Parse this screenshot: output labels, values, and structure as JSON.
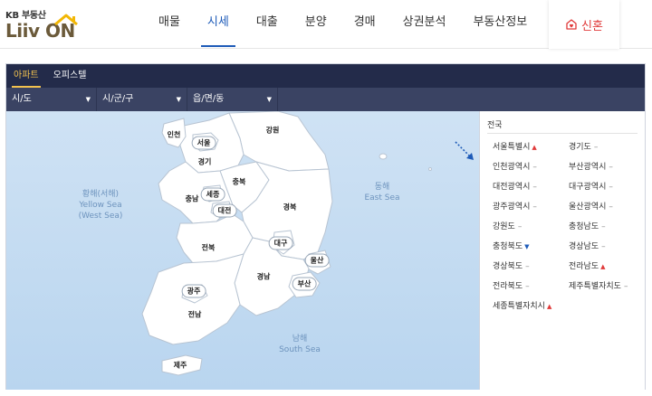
{
  "header": {
    "logo_kb": "KB 부동산",
    "logo_main": "Liiv ON",
    "nav": [
      "매물",
      "시세",
      "대출",
      "분양",
      "경매",
      "상권분석",
      "부동산정보"
    ],
    "active_nav_index": 1,
    "newlywed_label": "신혼"
  },
  "tabs": [
    "아파트",
    "오피스텔"
  ],
  "active_tab_index": 0,
  "filters": {
    "sido": "시/도",
    "sigungu": "시/군/구",
    "eupmyeondong": "읍/면/동"
  },
  "map": {
    "west_sea_ko": "황해(서해)",
    "west_sea_en1": "Yellow Sea",
    "west_sea_en2": "(West Sea)",
    "east_sea_ko": "동해",
    "east_sea_en": "East Sea",
    "south_sea_ko": "남해",
    "south_sea_en": "South Sea",
    "regions": {
      "incheon": "인천",
      "seoul": "서울",
      "gyeonggi": "경기",
      "gangwon": "강원",
      "chungbuk": "충북",
      "chungnam": "충남",
      "sejong": "세종",
      "daejeon": "대전",
      "gyeongbuk": "경북",
      "daegu": "대구",
      "jeonbuk": "전북",
      "ulsan": "울산",
      "gyeongnam": "경남",
      "busan": "부산",
      "gwangju": "광주",
      "jeonnam": "전남",
      "jeju": "제주"
    }
  },
  "region_list": {
    "title": "전국",
    "items": [
      {
        "name": "서울특별시",
        "trend": "up"
      },
      {
        "name": "경기도",
        "trend": "flat"
      },
      {
        "name": "인천광역시",
        "trend": "flat"
      },
      {
        "name": "부산광역시",
        "trend": "flat"
      },
      {
        "name": "대전광역시",
        "trend": "flat"
      },
      {
        "name": "대구광역시",
        "trend": "flat"
      },
      {
        "name": "광주광역시",
        "trend": "flat"
      },
      {
        "name": "울산광역시",
        "trend": "flat"
      },
      {
        "name": "강원도",
        "trend": "flat"
      },
      {
        "name": "충청남도",
        "trend": "flat"
      },
      {
        "name": "충청북도",
        "trend": "down"
      },
      {
        "name": "경상남도",
        "trend": "flat"
      },
      {
        "name": "경상북도",
        "trend": "flat"
      },
      {
        "name": "전라남도",
        "trend": "up"
      },
      {
        "name": "전라북도",
        "trend": "flat"
      },
      {
        "name": "제주특별자치도",
        "trend": "flat"
      },
      {
        "name": "세종특별자치시",
        "trend": "up"
      }
    ],
    "symbols": {
      "flat": "–",
      "up": "▲",
      "down": "▼"
    }
  },
  "colors": {
    "accent": "#1e5bb8",
    "tab_active": "#f2c14e",
    "up": "#e03a3a",
    "down": "#1e5bb8"
  }
}
